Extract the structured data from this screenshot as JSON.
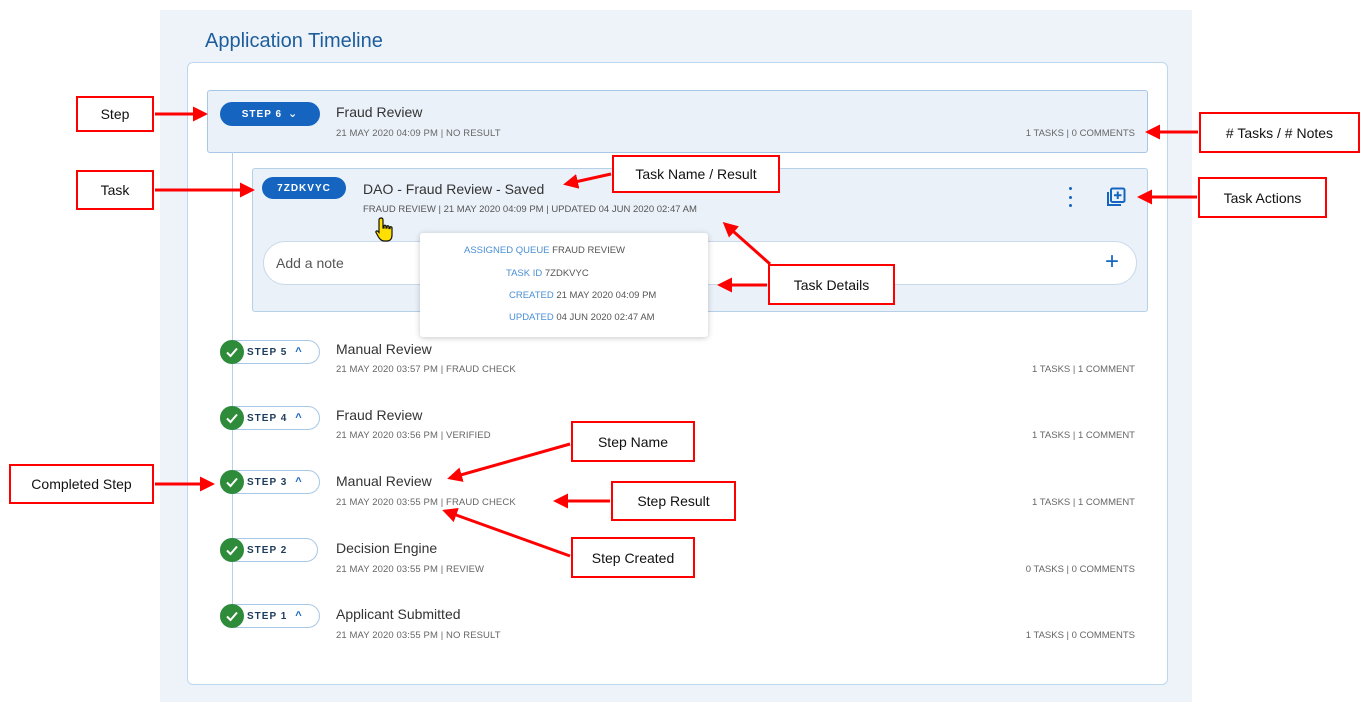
{
  "panel": {
    "title": "Application Timeline"
  },
  "current_step": {
    "badge": "STEP 6",
    "name": "Fraud Review",
    "meta": "21 MAY 2020 04:09 PM | NO RESULT",
    "counts": "1 TASKS | 0 COMMENTS"
  },
  "task": {
    "badge": "7ZDKVYC",
    "name": "DAO - Fraud Review - Saved",
    "meta": "FRAUD REVIEW | 21 MAY 2020 04:09 PM | UPDATED 04 JUN 2020 02:47 AM",
    "note_placeholder": "Add a note"
  },
  "tooltip": {
    "rows": [
      {
        "key": "ASSIGNED QUEUE",
        "value": "FRAUD REVIEW"
      },
      {
        "key": "TASK ID",
        "value": "7ZDKVYC"
      },
      {
        "key": "CREATED",
        "value": "21 MAY 2020 04:09 PM"
      },
      {
        "key": "UPDATED",
        "value": "04 JUN 2020 02:47 AM"
      }
    ]
  },
  "completed_steps": [
    {
      "badge": "STEP 5",
      "name": "Manual Review",
      "meta": "21 MAY 2020 03:57 PM | FRAUD CHECK",
      "counts": "1 TASKS | 1 COMMENT"
    },
    {
      "badge": "STEP 4",
      "name": "Fraud Review",
      "meta": "21 MAY 2020 03:56 PM | VERIFIED",
      "counts": "1 TASKS | 1 COMMENT"
    },
    {
      "badge": "STEP 3",
      "name": "Manual Review",
      "meta": "21 MAY 2020 03:55 PM | FRAUD CHECK",
      "counts": "1 TASKS | 1 COMMENT"
    },
    {
      "badge": "STEP 2",
      "name": "Decision Engine",
      "meta": "21 MAY 2020 03:55 PM | REVIEW",
      "counts": "0 TASKS | 0 COMMENTS"
    },
    {
      "badge": "STEP 1",
      "name": "Applicant Submitted",
      "meta": "21 MAY 2020 03:55 PM | NO RESULT",
      "counts": "1 TASKS | 0 COMMENTS"
    }
  ],
  "callouts": {
    "step": "Step",
    "task": "Task",
    "completed_step": "Completed Step",
    "task_name_result": "Task Name / Result",
    "tasks_notes": "# Tasks / # Notes",
    "task_actions": "Task Actions",
    "task_details": "Task Details",
    "step_name": "Step Name",
    "step_result": "Step Result",
    "step_created": "Step Created"
  },
  "colors": {
    "accent": "#1565c0",
    "complete": "#2e8b3a",
    "callout": "#ff0000",
    "tooltip_key": "#4a8fd4"
  },
  "icons": {
    "chevron_down": "chevron-down-icon",
    "chevron_up": "chevron-up-icon",
    "check": "check-icon",
    "kebab": "more-vert-icon",
    "add_box": "add-box-icon",
    "plus": "plus-icon",
    "cursor": "hand-pointer-icon"
  }
}
